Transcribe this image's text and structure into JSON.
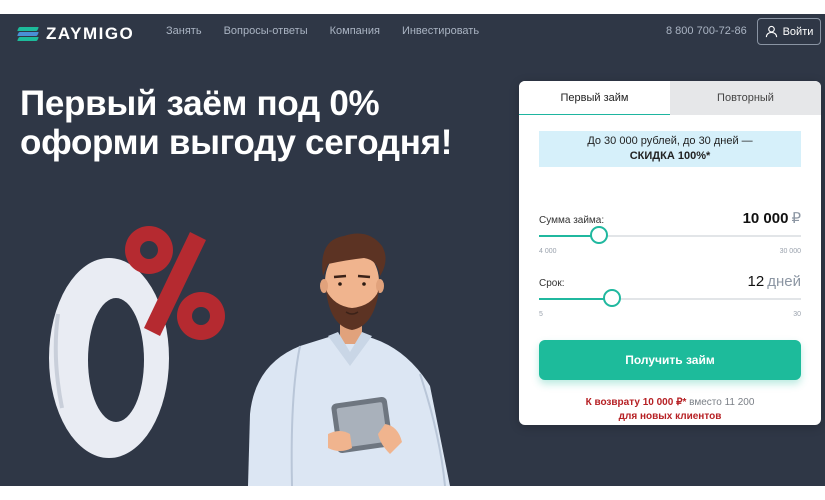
{
  "brand": {
    "name": "ZAYMIGO",
    "colors": {
      "accent": "#1dbb9b",
      "background": "#2f3746",
      "percent_red": "#b52a30"
    }
  },
  "nav": {
    "items": [
      "Занять",
      "Вопросы-ответы",
      "Компания",
      "Инвестировать"
    ],
    "phone": "8 800 700-72-86",
    "login_label": "Войти",
    "login_icon": "user-icon"
  },
  "hero": {
    "title_line1": "Первый заём под 0%",
    "title_line2": "оформи выгоду сегодня!",
    "graphic_zero": "0",
    "graphic_percent": "%"
  },
  "calculator": {
    "tabs": [
      "Первый займ",
      "Повторный"
    ],
    "active_tab": 0,
    "promo": {
      "line1": "До 30 000 рублей, до 30 дней —",
      "line2": "СКИДКА 100%*"
    },
    "amount": {
      "label": "Сумма займа:",
      "value": "10 000",
      "unit": "₽",
      "min_label": "4 000",
      "max_label": "30 000",
      "min": 4000,
      "max": 30000,
      "current": 10000
    },
    "term": {
      "label": "Срок:",
      "value": "12",
      "unit": "дней",
      "min_label": "5",
      "max_label": "30",
      "min": 5,
      "max": 30,
      "current": 12
    },
    "cta_label": "Получить займ",
    "repay": {
      "part1": "К возврату 10 000 ₽*",
      "part2": " вместо ",
      "part3": "11 200",
      "line2": "для новых клиентов"
    }
  }
}
